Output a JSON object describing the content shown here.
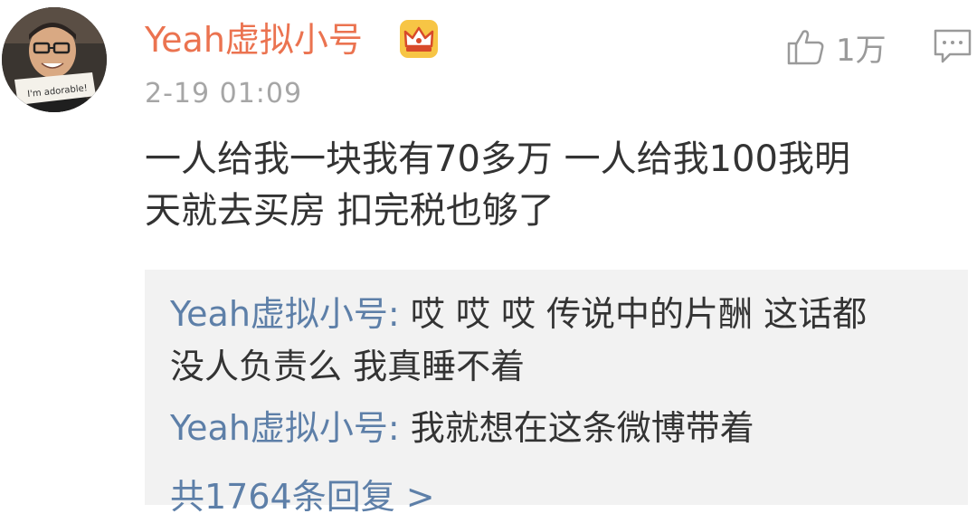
{
  "post": {
    "username": "Yeah虚拟小号",
    "time": "2-19 01:09",
    "like_count": "1万",
    "content_line1": "一人给我一块我有70多万 一人给我100我明",
    "content_line2": "天就去买房 扣完税也够了",
    "avatar_sign_text": "I'm adorable!",
    "vip_icon": "crown-icon",
    "like_icon": "thumb-up-icon",
    "comment_icon": "comment-icon"
  },
  "replies": [
    {
      "user": "Yeah虚拟小号:",
      "text_line1": " 哎 哎 哎 传说中的片酬 这话都",
      "text_line2": "没人负责么 我真睡不着"
    },
    {
      "user": "Yeah虚拟小号:",
      "text_line1": " 我就想在这条微博带着"
    }
  ],
  "more_replies": "共1764条回复 >",
  "colors": {
    "username": "#eb7350",
    "reply_user": "#5d7fa8",
    "text": "#333333",
    "meta": "#a6a6a6",
    "reply_bg": "#f2f2f2"
  }
}
